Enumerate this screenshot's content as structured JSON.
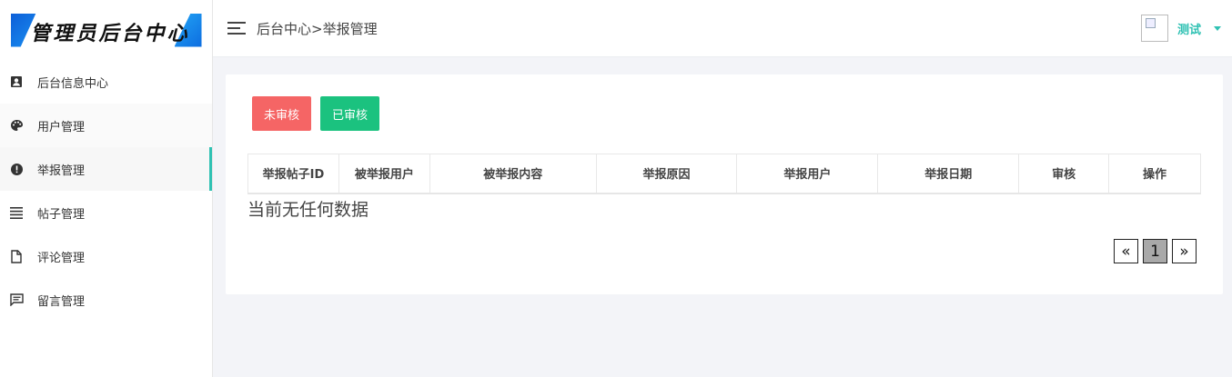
{
  "sidebar": {
    "logo_text": "管理员后台中心",
    "items": [
      {
        "label": "后台信息中心",
        "icon": "contact-card-icon"
      },
      {
        "label": "用户管理",
        "icon": "palette-icon"
      },
      {
        "label": "举报管理",
        "icon": "alert-circle-icon"
      },
      {
        "label": "帖子管理",
        "icon": "list-lines-icon"
      },
      {
        "label": "评论管理",
        "icon": "document-icon"
      },
      {
        "label": "留言管理",
        "icon": "message-icon"
      }
    ]
  },
  "header": {
    "breadcrumb": "后台中心>举报管理",
    "username": "测试",
    "menu_icon": "hamburger-menu-icon"
  },
  "main": {
    "buttons": {
      "unreviewed": "未审核",
      "reviewed": "已审核"
    },
    "table": {
      "columns": [
        "举报帖子ID",
        "被举报用户",
        "被举报内容",
        "举报原因",
        "举报用户",
        "举报日期",
        "审核",
        "操作"
      ],
      "rows": []
    },
    "empty_message": "当前无任何数据",
    "pagination": {
      "prev": "«",
      "current": "1",
      "next": "»"
    }
  },
  "colors": {
    "accent": "#2fc1b3",
    "danger": "#f56565",
    "success": "#1bc27f"
  }
}
